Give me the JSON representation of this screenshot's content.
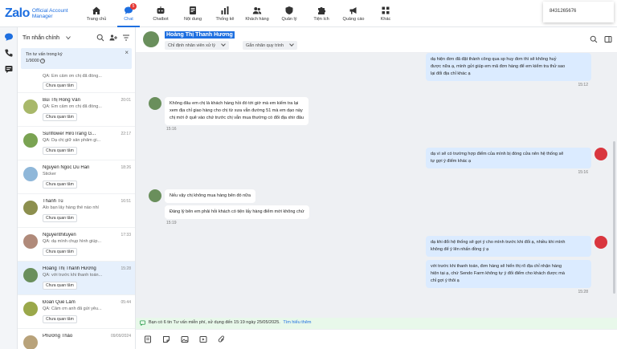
{
  "app": {
    "logo": "Zalo",
    "logo_sub_line1": "Official Account",
    "logo_sub_line2": "Manager",
    "phone": "8431265676"
  },
  "nav": {
    "items": [
      {
        "label": "Trang chủ",
        "icon": "home-icon"
      },
      {
        "label": "Chat",
        "icon": "chat-icon",
        "badge": "5",
        "active": true
      },
      {
        "label": "Chatbot",
        "icon": "chatbot-icon"
      },
      {
        "label": "Nội dung",
        "icon": "content-icon"
      },
      {
        "label": "Thống kê",
        "icon": "stats-icon"
      },
      {
        "label": "Khách hàng",
        "icon": "customers-icon"
      },
      {
        "label": "Quản lý",
        "icon": "shield-icon"
      },
      {
        "label": "Tiện ích",
        "icon": "puzzle-icon"
      },
      {
        "label": "Quảng cáo",
        "icon": "ads-icon"
      },
      {
        "label": "Khác",
        "icon": "grid-icon"
      }
    ]
  },
  "sidebar": {
    "title": "Tin nhắn chính",
    "promo_line1": "Tin tư vấn trong ký",
    "promo_line2": "1/9000"
  },
  "conversations": [
    {
      "name": "",
      "time": "",
      "snippet": "QA: Em cảm ơn chị đã đồng...",
      "tag": "Chưa quan tâm",
      "color": "#c9a27a",
      "partial": true
    },
    {
      "name": "Bùi Thị Hồng Vân",
      "time": "20:01",
      "snippet": "QA: Em cảm ơn chị đã đồng...",
      "tag": "Chưa quan tâm",
      "color": "#a8b86a"
    },
    {
      "name": "Sunflower HiroTrang G...",
      "time": "22:17",
      "snippet": "QA: Dạ chị giữ sản phẩm gi...",
      "tag": "Chưa quan tâm",
      "color": "#7aa352"
    },
    {
      "name": "Nguyen Ngoc Du Han",
      "time": "18:26",
      "snippet": "Sticker",
      "tag": "Chưa quan tâm",
      "color": "#8fb7d9"
    },
    {
      "name": "Thanh Tú",
      "time": "16:51",
      "snippet": "Alo bạn lấy hàng thế nào nhỉ",
      "tag": "Chưa quan tâm",
      "color": "#8c8f4e"
    },
    {
      "name": "Nguyenthituyen",
      "time": "17:33",
      "snippet": "QA: dạ mình chụp hình giúp...",
      "tag": "Chưa quan tâm",
      "color": "#b08a7a"
    },
    {
      "name": "Hoàng Thị Thanh Hương",
      "time": "15:28",
      "snippet": "QA: với trước khi thanh toán...",
      "tag": "Chưa quan tâm",
      "color": "#6a8f5c",
      "active": true
    },
    {
      "name": "Đoàn Quế Lâm",
      "time": "05:44",
      "snippet": "QA: Cảm ơn anh đã gửi yêu...",
      "tag": "Chưa quan tâm",
      "color": "#9aa84a"
    },
    {
      "name": "Phương Thảo",
      "time": "09/09/2024",
      "snippet": "",
      "tag": "",
      "color": "#b8a27a"
    }
  ],
  "chat": {
    "contact_name": "Hoàng Thị Thanh Hương",
    "chip_assign": "Chỉ định nhân viên xử lý",
    "chip_workflow": "Gắn nhãn quy trình",
    "messages": [
      {
        "dir": "out",
        "lines": [
          "dạ hiện đơn đã đặt thành công qua sp huy đơn thì sẽ không huỷ",
          "được nữa ạ, mình gửi giúp em mã đơn hàng để em kiểm tra thử sao",
          "lại đổi địa chỉ khác ạ"
        ],
        "time": "15:12"
      },
      {
        "dir": "in",
        "lines": [
          "Không đâu em chị là khách hàng hồi đó tới giờ mà em kiểm tra lại",
          "xem địa chỉ giao hàng cho chị từ xưa vẫn đường 51 mà em dạo này",
          "chị mới ở quê vào chứ trước chị vẫn mua thường có đổi địa xhir đâu"
        ],
        "time": "15:16"
      },
      {
        "dir": "out",
        "lines": [
          "dạ vì sẽ có trường hợp điểm của mình bị đóng cửa nên hệ thống sẽ",
          "tự gợi ý điểm khác ạ"
        ],
        "time": "15:16"
      },
      {
        "dir": "in",
        "lines": [
          "Nếu vậy chị không mua hàng bên đó nữa"
        ],
        "time": ""
      },
      {
        "dir": "in",
        "lines": [
          "Đáng lý bên em phải hỏi khách có tiện lấy hàng điểm mới không chứ"
        ],
        "time": "15:19"
      },
      {
        "dir": "out",
        "lines": [
          "dạ khi đổi hệ thống sẽ gợi ý cho mình trước khi đổi ạ, nhiều khi mình",
          "không để ý lên nhấn đồng ý ạ"
        ],
        "time": ""
      },
      {
        "dir": "out",
        "lines": [
          "với trước khi thanh toán, đơn hàng sẽ hiển thị rõ địa chỉ nhận hàng",
          "hiện tại ạ, chứ Sendo Farm không tự ý đổi điểm cho khách được mà",
          "chỉ gợi ý thôi ạ"
        ],
        "time": "15:28"
      }
    ],
    "notice_text": "Bạn có 6 tin Tư vấn miễn phí, sử dụng đến 15:19 ngày 25/05/2025.",
    "notice_link": "Tìm hiểu thêm"
  },
  "colors": {
    "accent": "#1e6fe0",
    "out_bubble": "#dbebff",
    "chat_bg": "#eef0f3",
    "agent_avatar": "#d9363e"
  }
}
